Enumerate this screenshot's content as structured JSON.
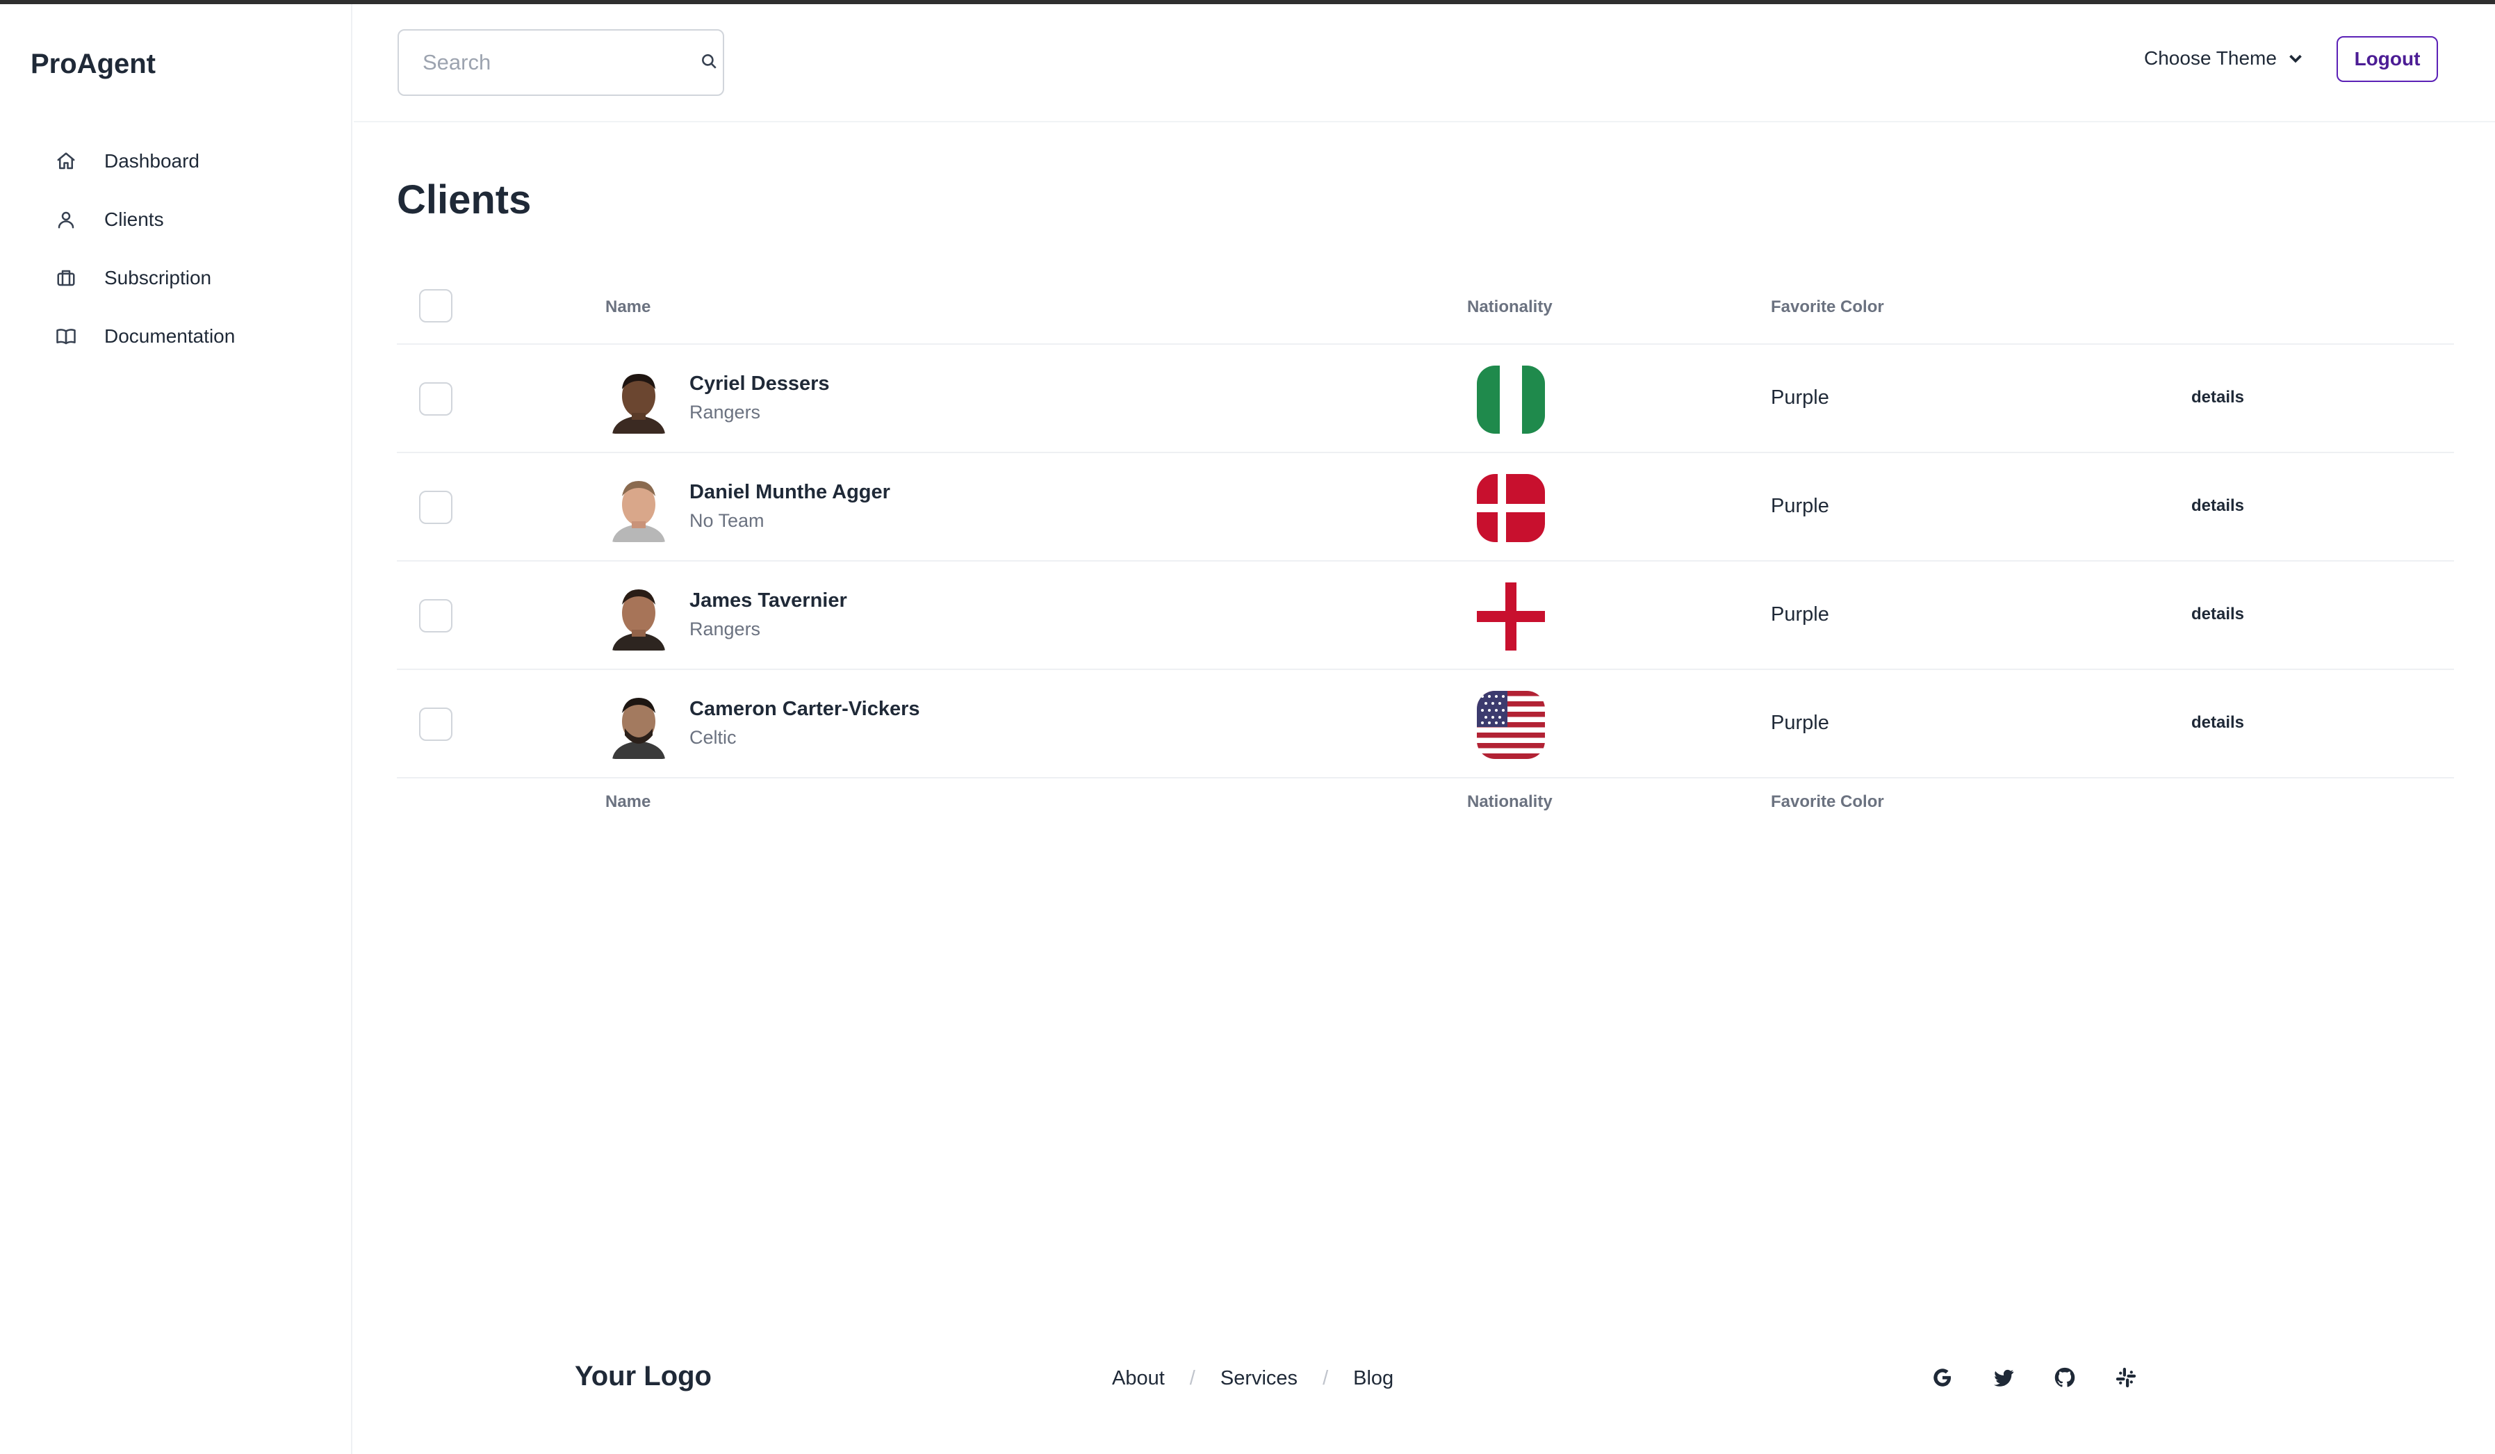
{
  "app": {
    "brand": "ProAgent"
  },
  "sidebar": {
    "items": [
      {
        "label": "Dashboard",
        "icon": "home-icon"
      },
      {
        "label": "Clients",
        "icon": "user-icon"
      },
      {
        "label": "Subscription",
        "icon": "briefcase-icon"
      },
      {
        "label": "Documentation",
        "icon": "book-icon"
      }
    ]
  },
  "header": {
    "search_placeholder": "Search",
    "theme_label": "Choose Theme",
    "logout_label": "Logout"
  },
  "main": {
    "title": "Clients",
    "columns": {
      "name": "Name",
      "nationality": "Nationality",
      "favorite_color": "Favorite Color"
    },
    "rows": [
      {
        "name": "Cyriel Dessers",
        "team": "Rangers",
        "flag": "nigeria-flag",
        "color": "Purple",
        "action": "details"
      },
      {
        "name": "Daniel Munthe Agger",
        "team": "No Team",
        "flag": "denmark-flag",
        "color": "Purple",
        "action": "details"
      },
      {
        "name": "James Tavernier",
        "team": "Rangers",
        "flag": "england-flag",
        "color": "Purple",
        "action": "details"
      },
      {
        "name": "Cameron Carter-Vickers",
        "team": "Celtic",
        "flag": "usa-flag",
        "color": "Purple",
        "action": "details"
      }
    ]
  },
  "footer": {
    "logo": "Your Logo",
    "links": [
      "About",
      "Services",
      "Blog"
    ],
    "separator": "/",
    "socials": [
      "google-icon",
      "twitter-icon",
      "github-icon",
      "slack-icon"
    ]
  },
  "colors": {
    "accent": "#5b21b6",
    "text": "#1f2937",
    "muted": "#6b7280",
    "border": "#eef0f3"
  }
}
